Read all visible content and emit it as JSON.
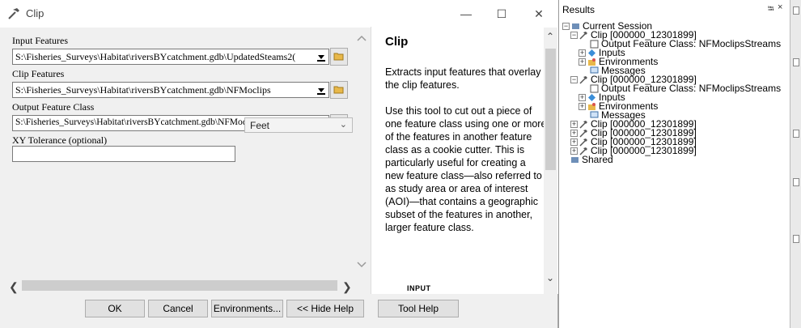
{
  "dialog": {
    "title": "Clip",
    "controls": {
      "minimize": "—",
      "maximize": "☐",
      "close": "✕"
    }
  },
  "params": {
    "input_features": {
      "label": "Input Features",
      "value": "S:\\Fisheries_Surveys\\Habitat\\riversBYcatchment.gdb\\UpdatedSteams2("
    },
    "clip_features": {
      "label": "Clip Features",
      "value": "S:\\Fisheries_Surveys\\Habitat\\riversBYcatchment.gdb\\NFMoclips"
    },
    "output_feature_class": {
      "label": "Output Feature Class",
      "value": "S:\\Fisheries_Surveys\\Habitat\\riversBYcatchment.gdb\\NFMoclipsStreams"
    },
    "xy_tolerance": {
      "label": "XY Tolerance (optional)",
      "value": "",
      "units": "Feet"
    }
  },
  "help": {
    "title": "Clip",
    "desc1": "Extracts input features that overlay the clip features.",
    "desc2": "Use this tool to cut out a piece of one feature class using one or more of the features in another feature class as a cookie cutter. This is particularly useful for creating a new feature class—also referred to as study area or area of interest (AOI)—that contains a geographic subset of the features in another, larger feature class.",
    "section": "INPUT"
  },
  "buttons": {
    "ok": "OK",
    "cancel": "Cancel",
    "environments": "Environments...",
    "hide_help": "<< Hide Help",
    "tool_help": "Tool Help"
  },
  "results": {
    "title": "Results",
    "pin": "⭾",
    "close": "×",
    "current_session": "Current Session",
    "clip_item": "Clip [000000_12301899]",
    "output_item": "Output Feature Class: NFMoclipsStreams",
    "inputs": "Inputs",
    "environments": "Environments",
    "messages": "Messages",
    "shared": "Shared"
  }
}
